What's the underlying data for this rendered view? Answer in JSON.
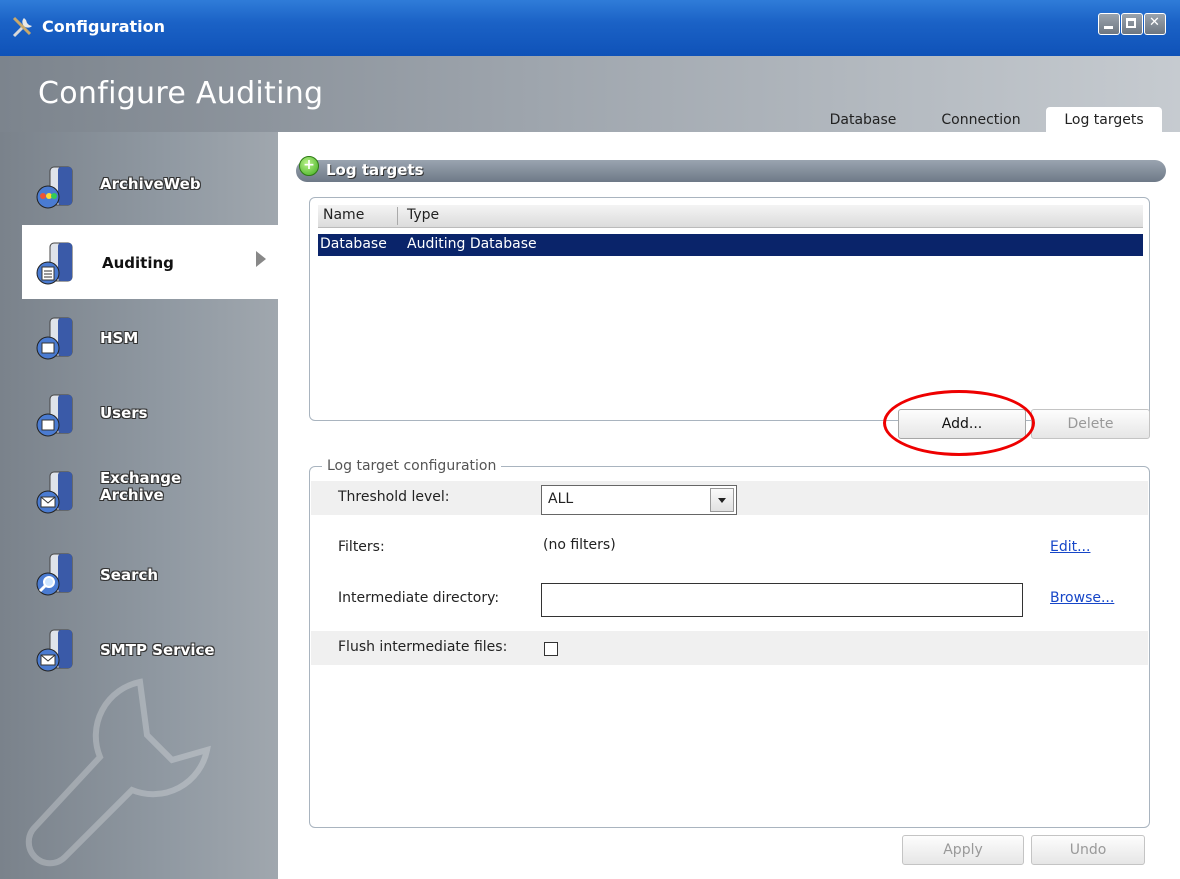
{
  "window": {
    "title": "Configuration"
  },
  "header": {
    "title": "Configure Auditing"
  },
  "tabs": [
    {
      "label": "Database"
    },
    {
      "label": "Connection"
    },
    {
      "label": "Log targets",
      "active": true
    }
  ],
  "sidebar": {
    "items": [
      {
        "label": "ArchiveWeb",
        "icon": "archiveweb-server-icon"
      },
      {
        "label": "Auditing",
        "icon": "auditing-server-icon",
        "active": true
      },
      {
        "label": "HSM",
        "icon": "hsm-server-icon"
      },
      {
        "label": "Users",
        "icon": "users-server-icon"
      },
      {
        "label": "Exchange Archive",
        "icon": "exchange-archive-server-icon"
      },
      {
        "label": "Search",
        "icon": "search-server-icon"
      },
      {
        "label": "SMTP Service",
        "icon": "smtp-server-icon"
      }
    ]
  },
  "log_targets": {
    "section_title": "Log targets",
    "columns": [
      "Name",
      "Type"
    ],
    "rows": [
      {
        "name": "Database",
        "type": "Auditing Database",
        "selected": true
      }
    ],
    "add_label": "Add...",
    "delete_label": "Delete"
  },
  "config": {
    "legend": "Log target configuration",
    "threshold_label": "Threshold level:",
    "threshold_value": "ALL",
    "filters_label": "Filters:",
    "filters_value": "(no filters)",
    "edit_link": "Edit...",
    "dir_label": "Intermediate directory:",
    "dir_value": "",
    "browse_link": "Browse...",
    "flush_label": "Flush intermediate files:",
    "flush_checked": false
  },
  "footer": {
    "apply_label": "Apply",
    "undo_label": "Undo"
  },
  "colors": {
    "selection": "#0a246a",
    "titlebar": "#1b62c6",
    "annotation_circle": "#ee0000",
    "link": "#1646c8"
  }
}
